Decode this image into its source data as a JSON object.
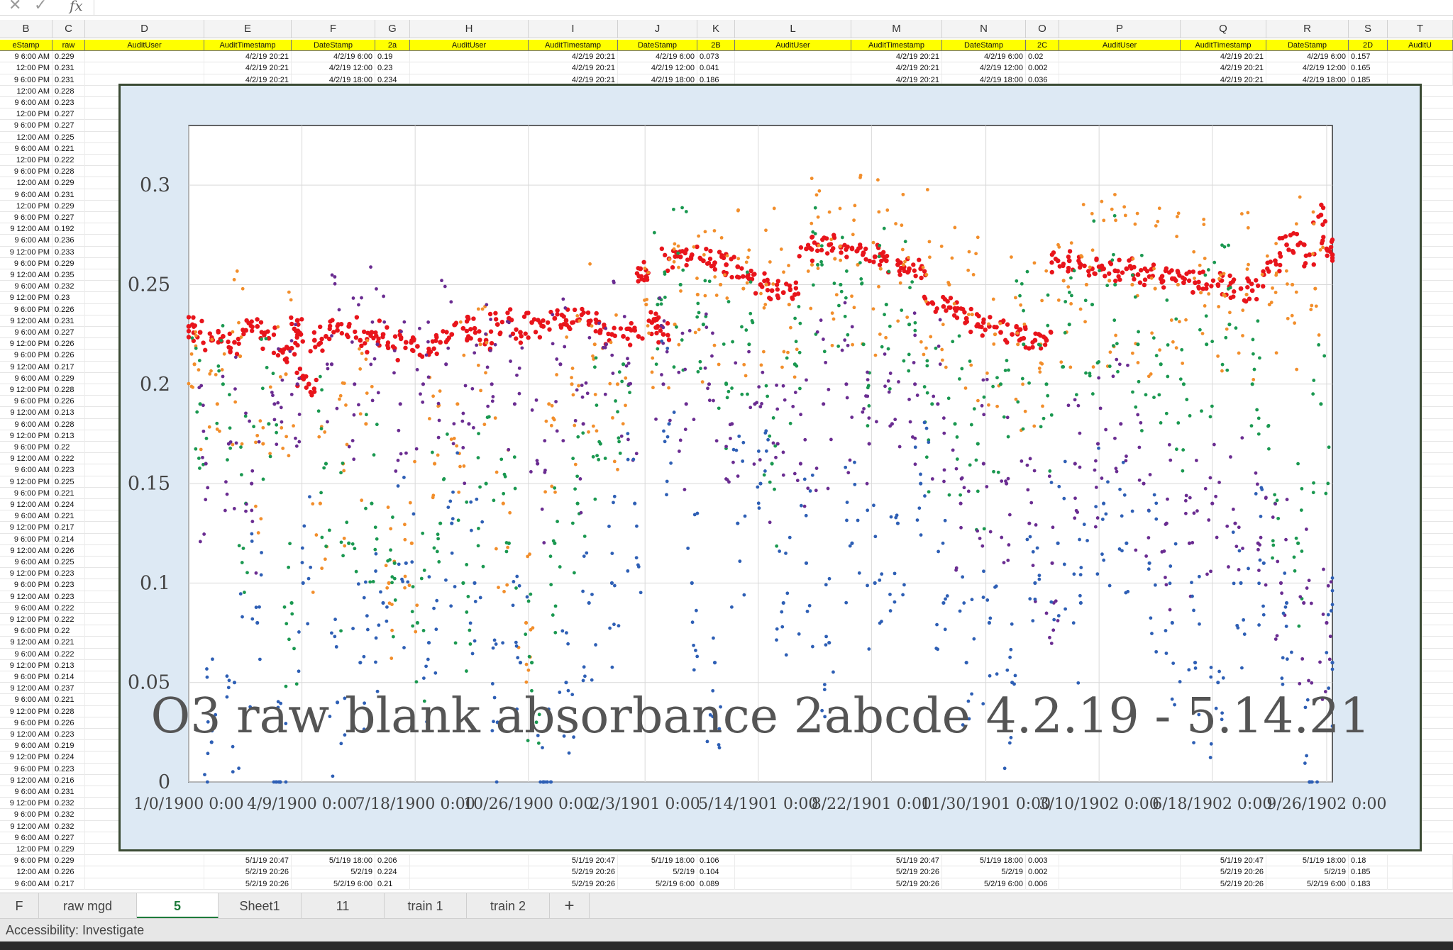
{
  "formula_bar": {
    "cancel_icon": "x-icon",
    "confirm_icon": "check-icon",
    "fx_label": "fx",
    "value": ""
  },
  "column_letters": [
    "B",
    "C",
    "D",
    "E",
    "F",
    "G",
    "H",
    "I",
    "J",
    "K",
    "L",
    "M",
    "N",
    "O",
    "P",
    "Q",
    "R",
    "S",
    "T"
  ],
  "field_headers": [
    "eStamp",
    "raw",
    "AuditUser",
    "AuditTimestamp",
    "DateStamp",
    "2a",
    "AuditUser",
    "AuditTimestamp",
    "DateStamp",
    "2B",
    "AuditUser",
    "AuditTimestamp",
    "DateStamp",
    "2C",
    "AuditUser",
    "AuditTimestamp",
    "DateStamp",
    "2D",
    "AuditU"
  ],
  "top_rows": [
    [
      "9 6:00 AM",
      "0.229",
      "",
      "4/2/19 20:21",
      "4/2/19 6:00",
      "0.19",
      "",
      "4/2/19 20:21",
      "4/2/19 6:00",
      "0.073",
      "",
      "4/2/19 20:21",
      "4/2/19 6:00",
      "0.02",
      "",
      "4/2/19 20:21",
      "4/2/19 6:00",
      "0.157",
      ""
    ],
    [
      "12:00 PM",
      "0.231",
      "",
      "4/2/19 20:21",
      "4/2/19 12:00",
      "0.23",
      "",
      "4/2/19 20:21",
      "4/2/19 12:00",
      "0.041",
      "",
      "4/2/19 20:21",
      "4/2/19 12:00",
      "0.002",
      "",
      "4/2/19 20:21",
      "4/2/19 12:00",
      "0.165",
      ""
    ],
    [
      "9 6:00 PM",
      "0.231",
      "",
      "4/2/19 20:21",
      "4/2/19 18:00",
      "0.234",
      "",
      "4/2/19 20:21",
      "4/2/19 18:00",
      "0.186",
      "",
      "4/2/19 20:21",
      "4/2/19 18:00",
      "0.036",
      "",
      "4/2/19 20:21",
      "4/2/19 18:00",
      "0.185",
      ""
    ]
  ],
  "left_rows": [
    [
      "12:00 AM",
      "0.228"
    ],
    [
      "9 6:00 AM",
      "0.223"
    ],
    [
      "12:00 PM",
      "0.227"
    ],
    [
      "9 6:00 PM",
      "0.227"
    ],
    [
      "12:00 AM",
      "0.225"
    ],
    [
      "9 6:00 AM",
      "0.221"
    ],
    [
      "12:00 PM",
      "0.222"
    ],
    [
      "9 6:00 PM",
      "0.228"
    ],
    [
      "12:00 AM",
      "0.229"
    ],
    [
      "9 6:00 AM",
      "0.231"
    ],
    [
      "12:00 PM",
      "0.229"
    ],
    [
      "9 6:00 PM",
      "0.227"
    ],
    [
      "9 12:00 AM",
      "0.192"
    ],
    [
      "9 6:00 AM",
      "0.236"
    ],
    [
      "9 12:00 PM",
      "0.233"
    ],
    [
      "9 6:00 PM",
      "0.229"
    ],
    [
      "9 12:00 AM",
      "0.235"
    ],
    [
      "9 6:00 AM",
      "0.232"
    ],
    [
      "9 12:00 PM",
      "0.23"
    ],
    [
      "9 6:00 PM",
      "0.226"
    ],
    [
      "9 12:00 AM",
      "0.231"
    ],
    [
      "9 6:00 AM",
      "0.227"
    ],
    [
      "9 12:00 PM",
      "0.226"
    ],
    [
      "9 6:00 PM",
      "0.226"
    ],
    [
      "9 12:00 AM",
      "0.217"
    ],
    [
      "9 6:00 AM",
      "0.229"
    ],
    [
      "9 12:00 PM",
      "0.228"
    ],
    [
      "9 6:00 PM",
      "0.226"
    ],
    [
      "9 12:00 AM",
      "0.213"
    ],
    [
      "9 6:00 AM",
      "0.228"
    ],
    [
      "9 12:00 PM",
      "0.213"
    ],
    [
      "9 6:00 PM",
      "0.22"
    ],
    [
      "9 12:00 AM",
      "0.222"
    ],
    [
      "9 6:00 AM",
      "0.223"
    ],
    [
      "9 12:00 PM",
      "0.225"
    ],
    [
      "9 6:00 PM",
      "0.221"
    ],
    [
      "9 12:00 AM",
      "0.224"
    ],
    [
      "9 6:00 AM",
      "0.221"
    ],
    [
      "9 12:00 PM",
      "0.217"
    ],
    [
      "9 6:00 PM",
      "0.214"
    ],
    [
      "9 12:00 AM",
      "0.226"
    ],
    [
      "9 6:00 AM",
      "0.225"
    ],
    [
      "9 12:00 PM",
      "0.223"
    ],
    [
      "9 6:00 PM",
      "0.223"
    ],
    [
      "9 12:00 AM",
      "0.223"
    ],
    [
      "9 6:00 AM",
      "0.222"
    ],
    [
      "9 12:00 PM",
      "0.222"
    ],
    [
      "9 6:00 PM",
      "0.22"
    ],
    [
      "9 12:00 AM",
      "0.221"
    ],
    [
      "9 6:00 AM",
      "0.222"
    ],
    [
      "9 12:00 PM",
      "0.213"
    ],
    [
      "9 6:00 PM",
      "0.214"
    ],
    [
      "9 12:00 AM",
      "0.237"
    ],
    [
      "9 6:00 AM",
      "0.221"
    ],
    [
      "9 12:00 PM",
      "0.228"
    ],
    [
      "9 6:00 PM",
      "0.226"
    ],
    [
      "9 12:00 AM",
      "0.223"
    ],
    [
      "9 6:00 AM",
      "0.219"
    ],
    [
      "9 12:00 PM",
      "0.224"
    ],
    [
      "9 6:00 PM",
      "0.223"
    ],
    [
      "9 12:00 AM",
      "0.216"
    ],
    [
      "9 6:00 AM",
      "0.231"
    ],
    [
      "9 12:00 PM",
      "0.232"
    ],
    [
      "9 6:00 PM",
      "0.232"
    ],
    [
      "9 12:00 AM",
      "0.232"
    ],
    [
      "9 6:00 AM",
      "0.227"
    ],
    [
      "12:00 PM",
      "0.229"
    ]
  ],
  "bottom_rows": [
    [
      "9 6:00 PM",
      "0.229",
      "",
      "5/1/19 20:47",
      "5/1/19 18:00",
      "0.206",
      "",
      "5/1/19 20:47",
      "5/1/19 18:00",
      "0.106",
      "",
      "5/1/19 20:47",
      "5/1/19 18:00",
      "0.003",
      "",
      "5/1/19 20:47",
      "5/1/19 18:00",
      "0.18",
      ""
    ],
    [
      "12:00 AM",
      "0.226",
      "",
      "5/2/19 20:26",
      "5/2/19",
      "0.224",
      "",
      "5/2/19 20:26",
      "5/2/19",
      "0.104",
      "",
      "5/2/19 20:26",
      "5/2/19",
      "0.002",
      "",
      "5/2/19 20:26",
      "5/2/19",
      "0.185",
      ""
    ],
    [
      "9 6:00 AM",
      "0.217",
      "",
      "5/2/19 20:26",
      "5/2/19 6:00",
      "0.21",
      "",
      "5/2/19 20:26",
      "5/2/19 6:00",
      "0.089",
      "",
      "5/2/19 20:26",
      "5/2/19 6:00",
      "0.006",
      "",
      "5/2/19 20:26",
      "5/2/19 6:00",
      "0.183",
      ""
    ]
  ],
  "chart_data": {
    "type": "scatter",
    "title": "O3 raw blank absorbance 2abcde 4.2.19 - 5.14.21",
    "xlabel": "",
    "ylabel": "",
    "xlim": [
      0,
      1000
    ],
    "ylim": [
      0,
      0.33
    ],
    "x_tick_labels": [
      "1/0/1900 0:00",
      "4/9/1900 0:00",
      "7/18/1900 0:00",
      "10/26/1900 0:00",
      "2/3/1901 0:00",
      "5/14/1901 0:00",
      "8/22/1901 0:00",
      "11/30/1901 0:00",
      "3/10/1902 0:00",
      "6/18/1902 0:00",
      "9/26/1902 0:00"
    ],
    "x_tick_values": [
      0,
      99,
      198,
      297,
      399,
      498,
      597,
      697,
      796,
      895,
      995
    ],
    "y_tick_labels": [
      "0",
      "0.05",
      "0.1",
      "0.15",
      "0.2",
      "0.25",
      "0.3"
    ],
    "y_tick_values": [
      0,
      0.05,
      0.1,
      0.15,
      0.2,
      0.25,
      0.3
    ],
    "grid": true,
    "legend": "none",
    "series": [
      {
        "color": "#e8141b",
        "x": [
          0,
          10,
          20,
          30,
          40,
          50,
          60,
          70,
          80,
          90,
          95,
          98,
          100,
          105,
          110,
          120,
          130,
          140,
          150,
          160,
          170,
          180,
          190,
          200,
          210,
          220,
          230,
          240,
          250,
          260,
          270,
          280,
          290,
          300,
          310,
          320,
          330,
          340,
          350,
          360,
          370,
          380,
          390,
          395,
          400,
          405,
          410,
          415,
          420,
          430,
          440,
          450,
          460,
          470,
          480,
          490,
          500,
          510,
          520,
          530,
          540,
          550,
          560,
          570,
          580,
          590,
          600,
          610,
          620,
          630,
          640,
          650,
          660,
          670,
          680,
          690,
          700,
          710,
          720,
          730,
          740,
          750,
          760,
          770,
          780,
          790,
          800,
          810,
          820,
          830,
          840,
          850,
          860,
          870,
          880,
          890,
          900,
          910,
          920,
          930,
          940,
          950,
          960,
          970,
          980,
          990,
          995,
          1000
        ],
        "y": [
          0.229,
          0.226,
          0.222,
          0.224,
          0.221,
          0.227,
          0.229,
          0.223,
          0.217,
          0.218,
          0.232,
          0.225,
          0.204,
          0.2,
          0.222,
          0.224,
          0.227,
          0.229,
          0.222,
          0.226,
          0.225,
          0.218,
          0.221,
          0.219,
          0.216,
          0.221,
          0.225,
          0.228,
          0.228,
          0.222,
          0.23,
          0.233,
          0.226,
          0.231,
          0.229,
          0.233,
          0.232,
          0.232,
          0.23,
          0.227,
          0.225,
          0.224,
          0.227,
          0.258,
          0.254,
          0.231,
          0.229,
          0.225,
          0.263,
          0.264,
          0.265,
          0.262,
          0.261,
          0.26,
          0.259,
          0.253,
          0.25,
          0.247,
          0.246,
          0.245,
          0.268,
          0.27,
          0.27,
          0.269,
          0.268,
          0.266,
          0.264,
          0.262,
          0.26,
          0.258,
          0.258,
          0.241,
          0.239,
          0.238,
          0.233,
          0.23,
          0.229,
          0.226,
          0.225,
          0.223,
          0.222,
          0.222,
          0.262,
          0.262,
          0.26,
          0.258,
          0.258,
          0.257,
          0.258,
          0.255,
          0.254,
          0.253,
          0.253,
          0.251,
          0.251,
          0.25,
          0.25,
          0.249,
          0.248,
          0.247,
          0.255,
          0.262,
          0.27,
          0.27,
          0.265,
          0.285,
          0.268,
          0.265
        ]
      },
      {
        "color": "#f28e2b",
        "x": [
          5,
          25,
          45,
          65,
          85,
          115,
          135,
          155,
          175,
          195,
          215,
          235,
          255,
          275,
          295,
          315,
          335,
          355,
          375,
          400,
          425,
          445,
          465,
          485,
          505,
          525,
          545,
          565,
          585,
          605,
          625,
          645,
          665,
          685,
          705,
          725,
          745,
          765,
          785,
          805,
          825,
          845,
          865,
          885,
          905,
          925,
          945,
          965,
          985
        ],
        "y": [
          0.21,
          0.19,
          0.214,
          0.17,
          0.205,
          0.14,
          0.16,
          0.18,
          0.1,
          0.12,
          0.16,
          0.19,
          0.22,
          0.14,
          0.08,
          0.19,
          0.2,
          0.22,
          0.2,
          0.24,
          0.23,
          0.245,
          0.25,
          0.248,
          0.25,
          0.24,
          0.26,
          0.263,
          0.26,
          0.258,
          0.26,
          0.255,
          0.25,
          0.235,
          0.225,
          0.22,
          0.22,
          0.252,
          0.25,
          0.252,
          0.25,
          0.248,
          0.25,
          0.246,
          0.245,
          0.245,
          0.24,
          0.25,
          0.248
        ]
      },
      {
        "color": "#1a9850",
        "x": [
          10,
          30,
          50,
          70,
          90,
          120,
          140,
          160,
          180,
          200,
          220,
          240,
          260,
          280,
          300,
          320,
          340,
          360,
          380,
          410,
          430,
          450,
          470,
          490,
          510,
          530,
          550,
          570,
          590,
          610,
          630,
          650,
          670,
          690,
          710,
          730,
          750,
          770,
          790,
          810,
          830,
          850,
          870,
          890,
          910,
          930,
          950,
          970,
          990
        ],
        "y": [
          0.19,
          0.2,
          0.14,
          0.18,
          0.09,
          0.16,
          0.12,
          0.14,
          0.11,
          0.08,
          0.13,
          0.1,
          0.15,
          0.12,
          0.06,
          0.12,
          0.14,
          0.17,
          0.21,
          0.24,
          0.25,
          0.23,
          0.2,
          0.22,
          0.16,
          0.21,
          0.26,
          0.25,
          0.22,
          0.24,
          0.23,
          0.19,
          0.18,
          0.17,
          0.2,
          0.22,
          0.2,
          0.23,
          0.24,
          0.25,
          0.22,
          0.21,
          0.2,
          0.22,
          0.23,
          0.2,
          0.14,
          0.12,
          0.19
        ]
      },
      {
        "color": "#6a2c91",
        "x": [
          15,
          35,
          55,
          75,
          95,
          125,
          145,
          165,
          185,
          205,
          225,
          245,
          265,
          285,
          305,
          325,
          345,
          365,
          385,
          415,
          435,
          455,
          475,
          495,
          515,
          535,
          555,
          575,
          595,
          615,
          635,
          655,
          675,
          695,
          715,
          735,
          755,
          775,
          795,
          815,
          835,
          855,
          875,
          895,
          915,
          935,
          955,
          975,
          995
        ],
        "y": [
          0.16,
          0.17,
          0.15,
          0.19,
          0.2,
          0.21,
          0.2,
          0.22,
          0.19,
          0.2,
          0.21,
          0.18,
          0.2,
          0.19,
          0.16,
          0.21,
          0.18,
          0.22,
          0.2,
          0.2,
          0.19,
          0.2,
          0.18,
          0.19,
          0.17,
          0.16,
          0.19,
          0.2,
          0.17,
          0.18,
          0.2,
          0.19,
          0.14,
          0.16,
          0.15,
          0.13,
          0.11,
          0.16,
          0.17,
          0.18,
          0.15,
          0.13,
          0.12,
          0.14,
          0.13,
          0.12,
          0.1,
          0.09,
          0.08
        ]
      },
      {
        "color": "#2e5fb5",
        "x": [
          20,
          40,
          60,
          80,
          100,
          130,
          150,
          170,
          190,
          210,
          230,
          250,
          270,
          290,
          310,
          330,
          350,
          370,
          390,
          420,
          440,
          460,
          480,
          500,
          520,
          540,
          560,
          580,
          600,
          620,
          640,
          660,
          680,
          700,
          720,
          740,
          760,
          780,
          800,
          820,
          840,
          860,
          880,
          900,
          920,
          940,
          960,
          980,
          1000
        ],
        "y": [
          0.02,
          0.05,
          0.08,
          0.0,
          0.1,
          0.04,
          0.06,
          0.09,
          0.11,
          0.07,
          0.13,
          0.1,
          0.03,
          0.06,
          0.0,
          0.05,
          0.09,
          0.1,
          0.14,
          0.18,
          0.1,
          0.06,
          0.13,
          0.15,
          0.09,
          0.11,
          0.07,
          0.12,
          0.1,
          0.13,
          0.15,
          0.09,
          0.06,
          0.08,
          0.05,
          0.1,
          0.12,
          0.09,
          0.14,
          0.12,
          0.11,
          0.08,
          0.06,
          0.05,
          0.1,
          0.11,
          0.09,
          0.0,
          0.06
        ]
      }
    ]
  },
  "sheet_tabs": [
    {
      "label": "F",
      "active": false
    },
    {
      "label": "raw mgd",
      "active": false
    },
    {
      "label": "5",
      "active": true
    },
    {
      "label": "Sheet1",
      "active": false
    },
    {
      "label": "11",
      "active": false
    },
    {
      "label": "train 1",
      "active": false
    },
    {
      "label": "train 2",
      "active": false
    }
  ],
  "add_sheet_label": "+",
  "status_bar": {
    "accessibility": "Accessibility: Investigate"
  }
}
